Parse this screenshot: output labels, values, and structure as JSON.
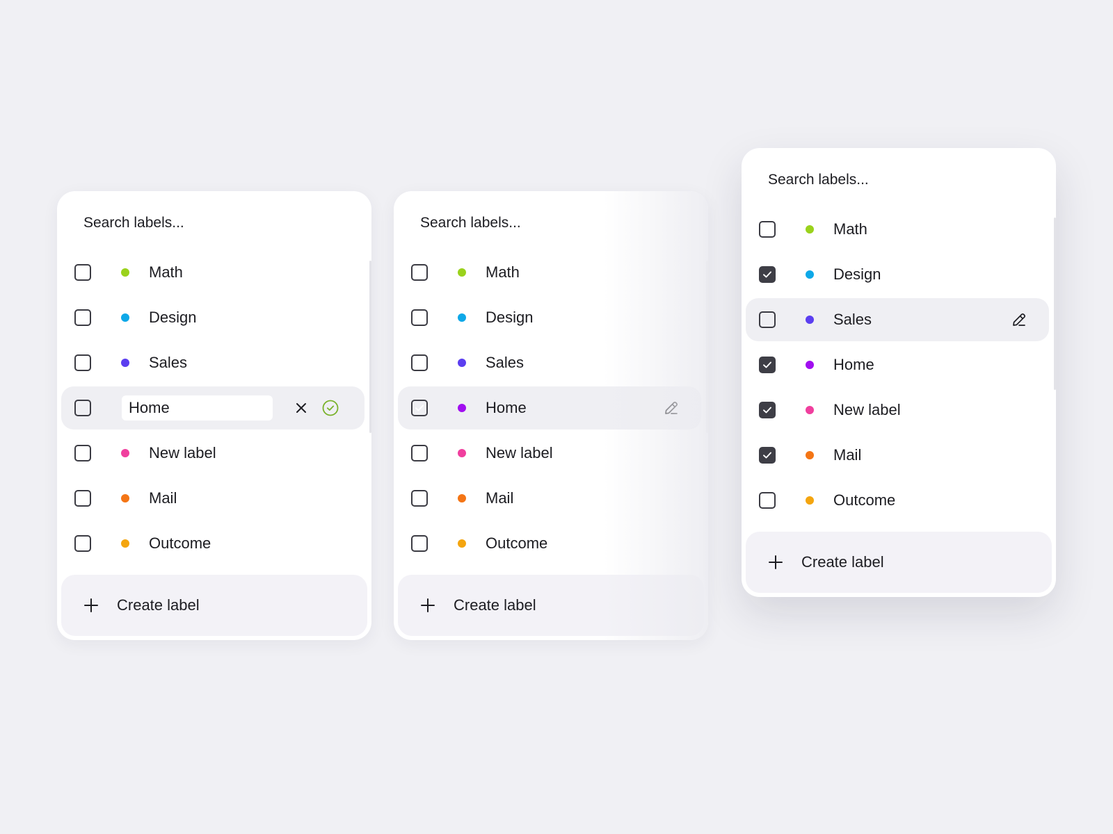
{
  "colors": {
    "Math": "#9ad21c",
    "Design": "#0ea8e8",
    "Sales": "#5b3ef0",
    "Home": "#a10ef0",
    "New label": "#f03f9e",
    "Mail": "#f47515",
    "Outcome": "#f4a50f",
    "confirm": "#7ab22b"
  },
  "panels": [
    {
      "search_placeholder": "Search labels...",
      "items": [
        {
          "name": "Math",
          "checked": false
        },
        {
          "name": "Design",
          "checked": false
        },
        {
          "name": "Sales",
          "checked": false
        },
        {
          "name": "Home",
          "checked": false,
          "state": "editing",
          "edit_value": "Home"
        },
        {
          "name": "New label",
          "checked": false
        },
        {
          "name": "Mail",
          "checked": false
        },
        {
          "name": "Outcome",
          "checked": false
        }
      ],
      "create_label": "Create label"
    },
    {
      "search_placeholder": "Search labels...",
      "items": [
        {
          "name": "Math",
          "checked": false
        },
        {
          "name": "Design",
          "checked": false
        },
        {
          "name": "Sales",
          "checked": false
        },
        {
          "name": "Home",
          "checked": true,
          "state": "hover"
        },
        {
          "name": "New label",
          "checked": false
        },
        {
          "name": "Mail",
          "checked": false
        },
        {
          "name": "Outcome",
          "checked": false
        }
      ],
      "create_label": "Create label"
    },
    {
      "search_placeholder": "Search labels...",
      "items": [
        {
          "name": "Math",
          "checked": false
        },
        {
          "name": "Design",
          "checked": true
        },
        {
          "name": "Sales",
          "checked": false,
          "state": "hover"
        },
        {
          "name": "Home",
          "checked": true
        },
        {
          "name": "New label",
          "checked": true
        },
        {
          "name": "Mail",
          "checked": true
        },
        {
          "name": "Outcome",
          "checked": false
        }
      ],
      "create_label": "Create label"
    }
  ]
}
